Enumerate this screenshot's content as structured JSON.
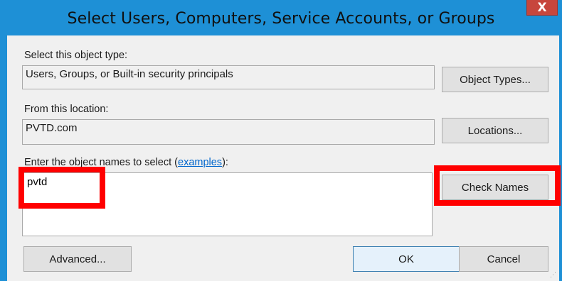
{
  "window": {
    "title": "Select Users, Computers, Service Accounts, or Groups",
    "close_label": "X"
  },
  "object_type": {
    "label": "Select this object type:",
    "value": "Users, Groups, or Built-in security principals",
    "button": "Object Types..."
  },
  "location": {
    "label": "From this location:",
    "value": "PVTD.com",
    "button": "Locations..."
  },
  "names": {
    "label_prefix": "Enter the object names to select (",
    "link": "examples",
    "label_suffix": "):",
    "value": "pvtd",
    "check_button": "Check Names"
  },
  "footer": {
    "advanced": "Advanced...",
    "ok": "OK",
    "cancel": "Cancel"
  },
  "annotations": {
    "highlight_color": "#ff0000"
  }
}
